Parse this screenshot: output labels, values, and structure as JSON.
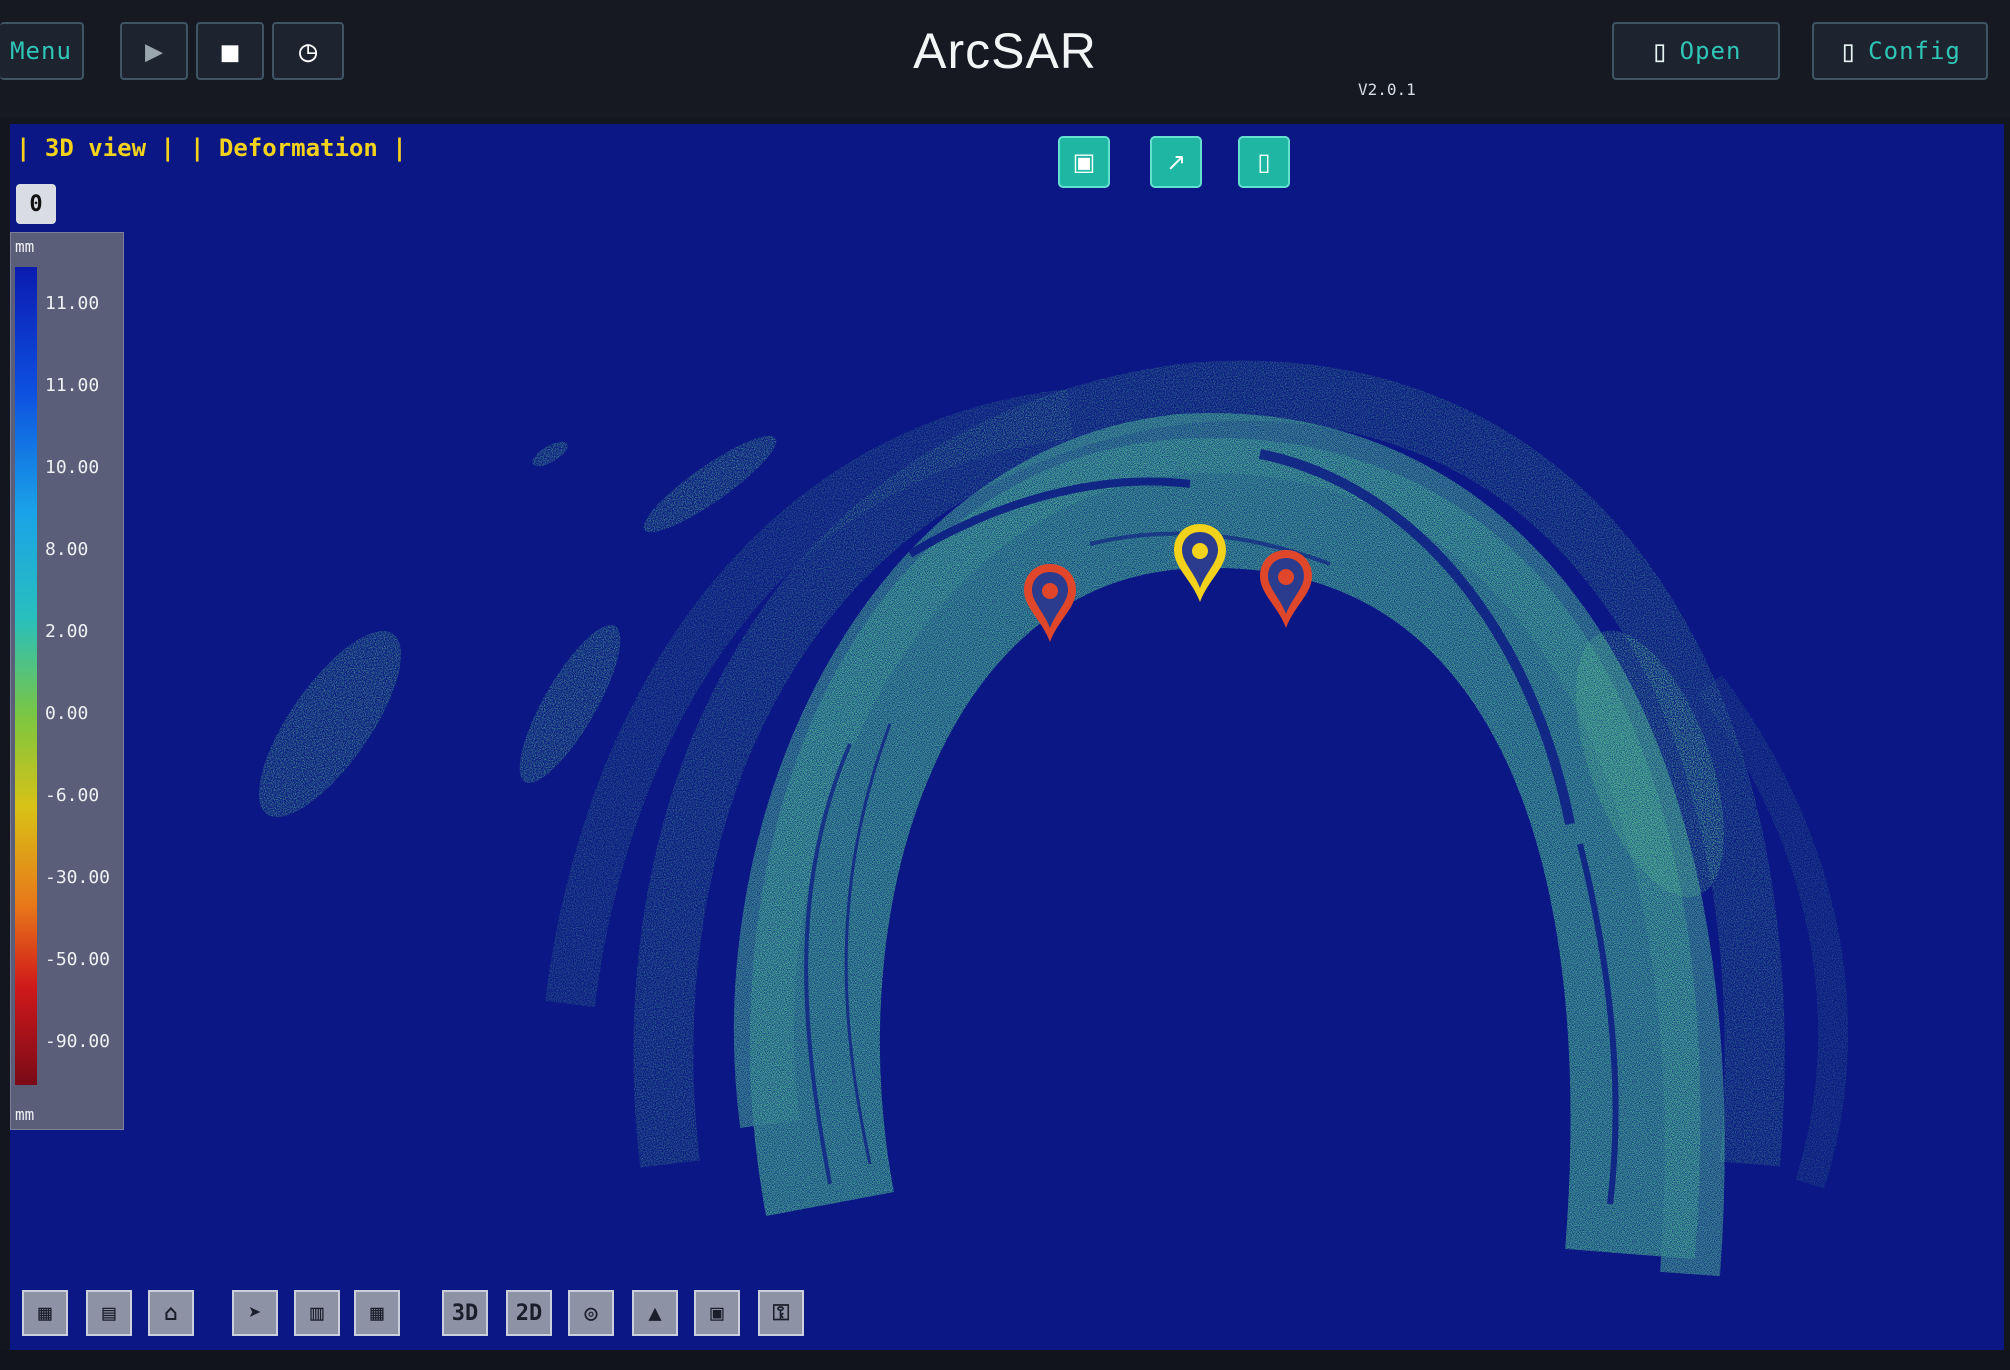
{
  "app": {
    "title": "ArcSAR",
    "version": "V2.0.1"
  },
  "toolbar_left": {
    "menu_label": "Menu",
    "play_icon": "play-icon",
    "stop_icon": "stop-icon",
    "record_icon": "clock-icon"
  },
  "toolbar_right": {
    "button1_label": "Open",
    "button2_label": "Config"
  },
  "viewport": {
    "mode_3d": "| 3D view |",
    "mode_deformation": "| Deformation |",
    "float_buttons": [
      "image-icon",
      "chart-icon",
      "document-icon"
    ],
    "legend_toggle": "0",
    "background_color": "#0b1784",
    "markers": [
      {
        "type": "alert",
        "color": "#e0472a"
      },
      {
        "type": "selected",
        "color": "#f2d21b"
      },
      {
        "type": "alert",
        "color": "#e0472a"
      }
    ]
  },
  "legend": {
    "unit_top": "mm",
    "unit_bottom": "mm",
    "ticks": [
      "11.00",
      "11.00",
      "10.00",
      "8.00",
      "2.00",
      "0.00",
      "-6.00",
      "-30.00",
      "-50.00",
      "-90.00"
    ]
  },
  "bottom_tools": [
    {
      "icon": "save-icon",
      "glyph": "▦"
    },
    {
      "icon": "layout-icon",
      "glyph": "▤"
    },
    {
      "icon": "home-icon",
      "glyph": "⌂"
    },
    {
      "icon": "cursor-icon",
      "glyph": "➤"
    },
    {
      "icon": "measure-icon",
      "glyph": "▥"
    },
    {
      "icon": "grid-icon",
      "glyph": "▦"
    },
    {
      "icon": "3d-view-icon",
      "glyph": "3D"
    },
    {
      "icon": "2d-view-icon",
      "glyph": "2D"
    },
    {
      "icon": "target-icon",
      "glyph": "◎"
    },
    {
      "icon": "terrain-icon",
      "glyph": "▲"
    },
    {
      "icon": "table-icon",
      "glyph": "▣"
    },
    {
      "icon": "lock-icon",
      "glyph": "⚿"
    }
  ]
}
